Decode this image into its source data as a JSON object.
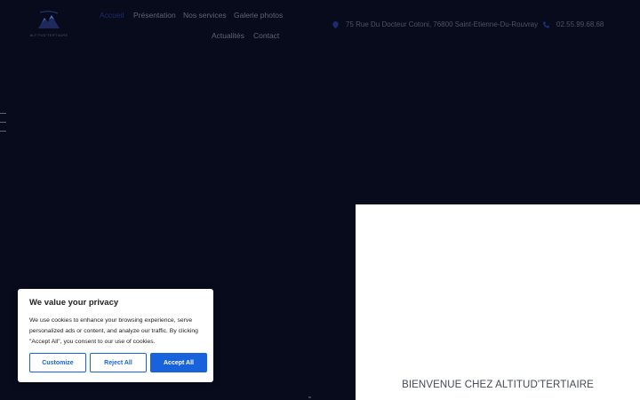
{
  "header": {
    "logo_text": "ALTITUD'TERTIAIRE"
  },
  "nav": {
    "items": [
      {
        "label": "Accueil"
      },
      {
        "label": "Présentation"
      },
      {
        "label": "Nos services"
      },
      {
        "label": "Galerie photos"
      },
      {
        "label": "Actualités"
      },
      {
        "label": "Contact"
      }
    ]
  },
  "contact": {
    "address": "75 Rue Du Docteur Cotoni, 76800 Saint-Etienne-Du-Rouvray",
    "phone": "02.55.99.68.68",
    "address_icon": "map-pin-icon",
    "phone_icon": "phone-icon"
  },
  "hero": {
    "welcome": "BIENVENUE CHEZ ALTITUD'TERTIAIRE"
  },
  "cookie": {
    "title": "We value your privacy",
    "text": "We use cookies to enhance your browsing experience, serve personalized ads or content, and analyze our traffic. By clicking \"Accept All\", you consent to our use of cookies.",
    "customize": "Customize",
    "reject": "Reject All",
    "accept": "Accept All"
  },
  "colors": {
    "background": "#080b1c",
    "accent": "#1863dc",
    "nav_active": "#1c2a6e"
  }
}
